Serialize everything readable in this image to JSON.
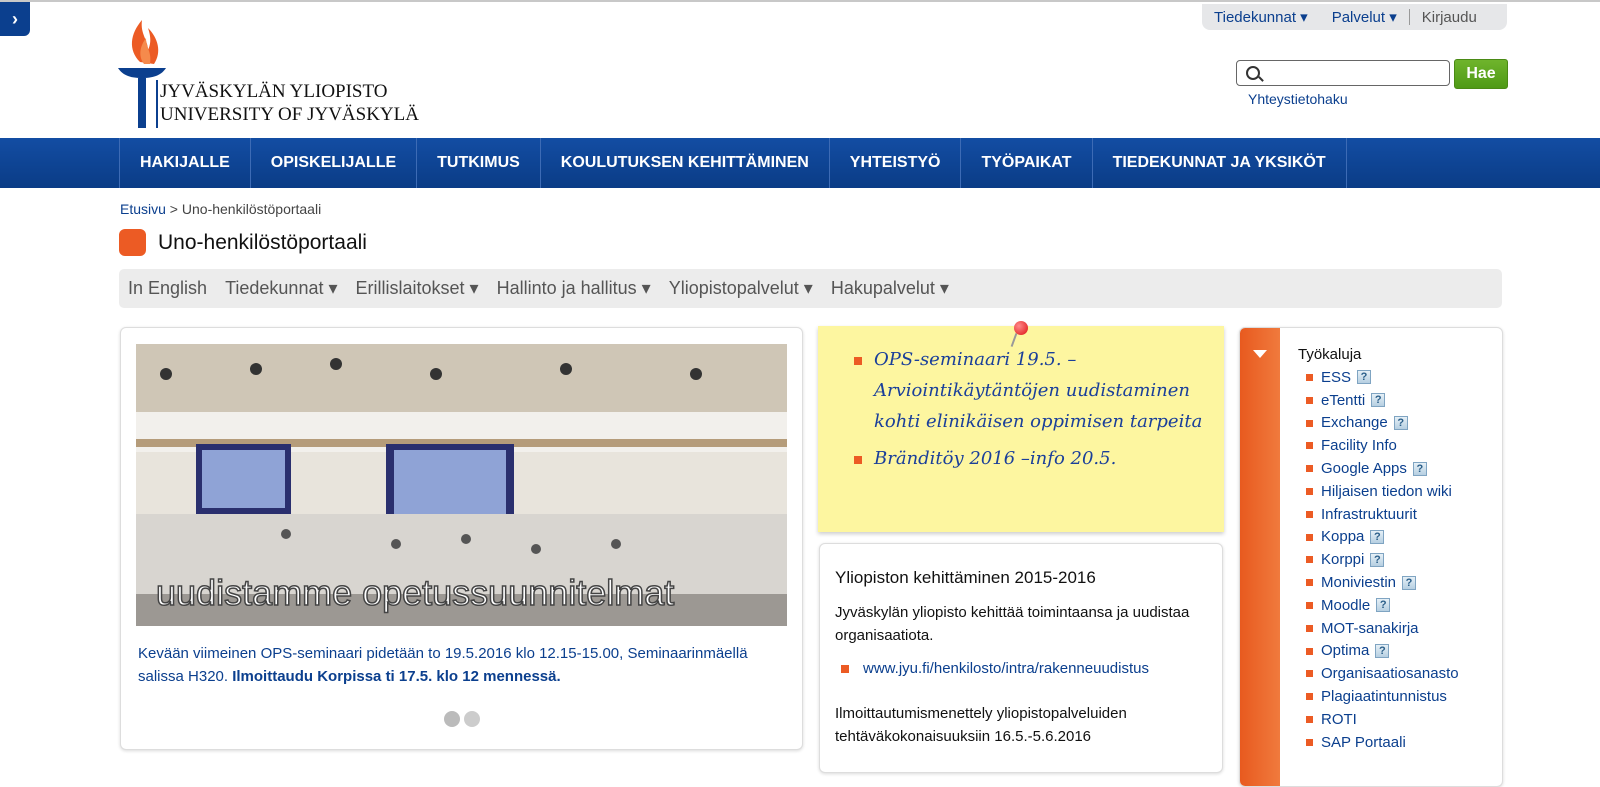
{
  "utility_nav": {
    "faculties": "Tiedekunnat ▾",
    "services": "Palvelut ▾",
    "login": "Kirjaudu"
  },
  "logo": {
    "line1": "JYVÄSKYLÄN YLIOPISTO",
    "line2": "UNIVERSITY OF JYVÄSKYLÄ"
  },
  "search": {
    "placeholder": "",
    "button": "Hae",
    "contact_link": "Yhteystietohaku"
  },
  "main_nav": [
    "HAKIJALLE",
    "OPISKELIJALLE",
    "TUTKIMUS",
    "KOULUTUKSEN KEHITTÄMINEN",
    "YHTEISTYÖ",
    "TYÖPAIKAT",
    "TIEDEKUNNAT JA YKSIKÖT"
  ],
  "breadcrumb": {
    "home": "Etusivu",
    "separator": " > ",
    "current": "Uno-henkilöstöportaali"
  },
  "page_title": "Uno-henkilöstöportaali",
  "sub_nav": [
    "In English",
    "Tiedekunnat ▾",
    "Erillislaitokset ▾",
    "Hallinto ja hallitus ▾",
    "Yliopistopalvelut ▾",
    "Hakupalvelut ▾"
  ],
  "hero": {
    "image_text": "uudistamme opetussuunnitelmat",
    "caption_normal": "Kevään viimeinen OPS-seminaari pidetään to 19.5.2016 klo 12.15-15.00, Seminaarinmäellä salissa H320. ",
    "caption_bold": "Ilmoittaudu Korpissa ti 17.5. klo 12 mennessä."
  },
  "note": {
    "items": [
      "OPS-seminaari 19.5. – Arviointikäytäntöjen uudistaminen kohti elinikäisen oppimisen tarpeita",
      "Bränditöy 2016 –info 20.5."
    ]
  },
  "development": {
    "title": "Yliopiston kehittäminen 2015-2016",
    "text": "Jyväskylän yliopisto kehittää toimintaansa ja uudistaa organisaatiota.",
    "link": "www.jyu.fi/henkilosto/intra/rakenneuudistus",
    "text2": "Ilmoittautumismenettely yliopistopalveluiden tehtäväkokonaisuuksiin 16.5.-5.6.2016"
  },
  "tools": {
    "title": "Työkaluja",
    "items": [
      {
        "label": "ESS",
        "help": true
      },
      {
        "label": "eTentti",
        "help": true
      },
      {
        "label": "Exchange",
        "help": true
      },
      {
        "label": "Facility Info",
        "help": false
      },
      {
        "label": "Google Apps",
        "help": true
      },
      {
        "label": "Hiljaisen tiedon wiki",
        "help": false
      },
      {
        "label": "Infrastruktuurit",
        "help": false
      },
      {
        "label": "Koppa",
        "help": true
      },
      {
        "label": "Korppi",
        "help": true
      },
      {
        "label": "Moniviestin",
        "help": true
      },
      {
        "label": "Moodle",
        "help": true
      },
      {
        "label": "MOT-sanakirja",
        "help": false
      },
      {
        "label": "Optima",
        "help": true
      },
      {
        "label": "Organisaatiosanasto",
        "help": false
      },
      {
        "label": "Plagiaatintunnistus",
        "help": false
      },
      {
        "label": "ROTI",
        "help": false
      },
      {
        "label": "SAP Portaali",
        "help": false
      }
    ],
    "help_glyph": "?"
  },
  "colors": {
    "brand_blue": "#0b3f8e",
    "accent_orange": "#ec5b24",
    "search_green": "#5aa51f",
    "note_yellow": "#fdf6a0"
  }
}
